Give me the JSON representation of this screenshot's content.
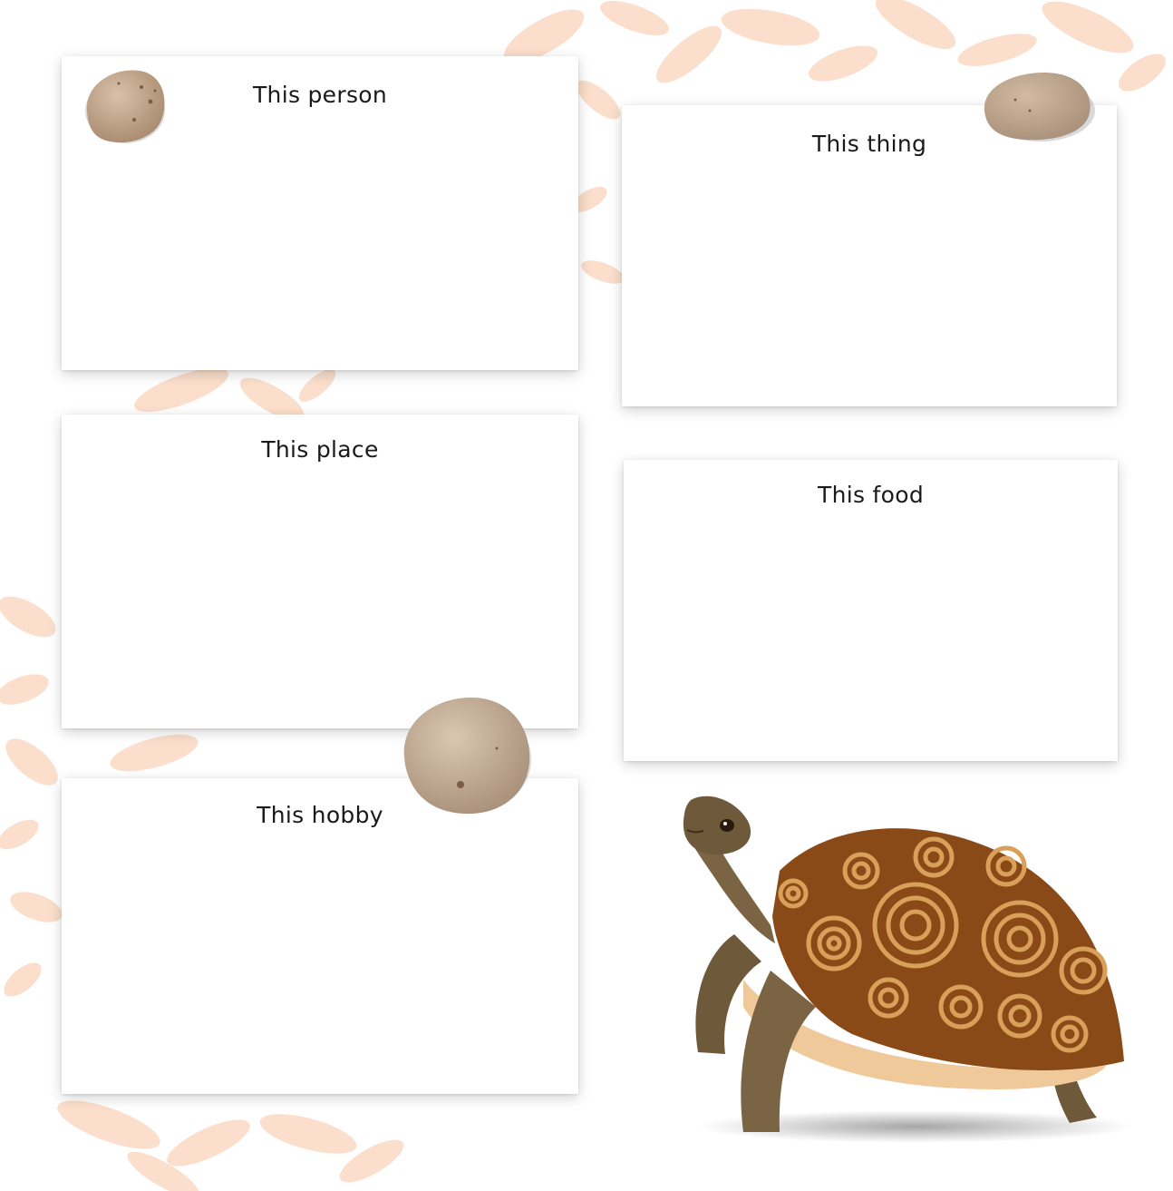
{
  "cards": {
    "person": {
      "title": "This person"
    },
    "thing": {
      "title": "This thing"
    },
    "place": {
      "title": "This place"
    },
    "food": {
      "title": "This food"
    },
    "hobby": {
      "title": "This hobby"
    }
  },
  "colors": {
    "splotch": "#fbd9c2",
    "pebble": "#b89c83",
    "shell_dark": "#8a4a17",
    "shell_light": "#d9a05a",
    "skin": "#6e5a3a",
    "plastron": "#f0c99a"
  },
  "icons": [
    "pebble-icon",
    "tortoise-illustration"
  ]
}
